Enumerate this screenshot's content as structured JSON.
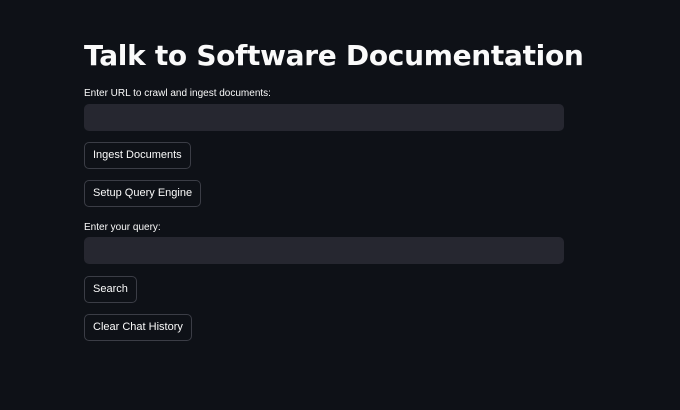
{
  "page": {
    "title": "Talk to Software Documentation"
  },
  "ingest": {
    "url_label": "Enter URL to crawl and ingest documents:",
    "url_value": "",
    "ingest_button": "Ingest Documents",
    "setup_button": "Setup Query Engine"
  },
  "query": {
    "query_label": "Enter your query:",
    "query_value": "",
    "search_button": "Search",
    "clear_button": "Clear Chat History"
  },
  "colors": {
    "background": "#0e1117",
    "input_background": "#262730",
    "button_border": "#3b3d46",
    "text": "#fafafa"
  }
}
